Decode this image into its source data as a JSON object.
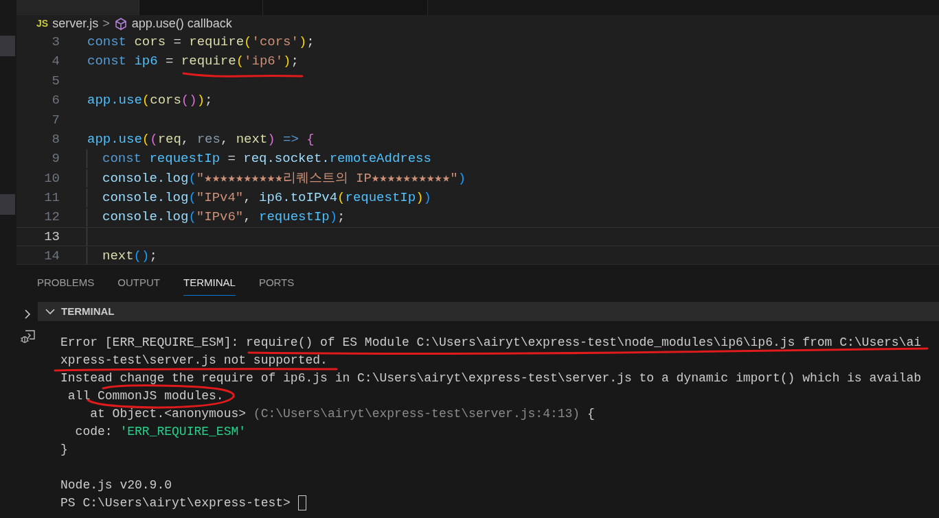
{
  "editor_tabs": [
    {
      "selected": true
    },
    {
      "selected": false
    },
    {
      "selected": false
    }
  ],
  "breadcrumb": {
    "file_badge": "JS",
    "file": "server.js",
    "separator": ">",
    "symbol": "app.use() callback"
  },
  "code_lines": [
    {
      "number": "3",
      "current": false,
      "guide": false,
      "tokens": [
        {
          "text": "const ",
          "color": "#569cd6"
        },
        {
          "text": "cors",
          "color": "#dcdcaa"
        },
        {
          "text": " = ",
          "color": "#d4d4d4"
        },
        {
          "text": "require",
          "color": "#dcdcaa"
        },
        {
          "text": "(",
          "color": "#ffd700"
        },
        {
          "text": "'cors'",
          "color": "#ce9178"
        },
        {
          "text": ")",
          "color": "#ffd700"
        },
        {
          "text": ";",
          "color": "#d4d4d4"
        }
      ]
    },
    {
      "number": "4",
      "current": false,
      "guide": false,
      "tokens": [
        {
          "text": "const ",
          "color": "#569cd6"
        },
        {
          "text": "ip6",
          "color": "#4fc1ff"
        },
        {
          "text": " = ",
          "color": "#d4d4d4"
        },
        {
          "text": "require",
          "color": "#dcdcaa"
        },
        {
          "text": "(",
          "color": "#ffd700"
        },
        {
          "text": "'ip6'",
          "color": "#ce9178"
        },
        {
          "text": ")",
          "color": "#ffd700"
        },
        {
          "text": ";",
          "color": "#d4d4d4"
        }
      ]
    },
    {
      "number": "5",
      "current": false,
      "guide": false
    },
    {
      "number": "6",
      "current": false,
      "guide": false,
      "tokens": [
        {
          "text": "app.use",
          "color": "#4fc1ff"
        },
        {
          "text": "(",
          "color": "#ffd700"
        },
        {
          "text": "cors",
          "color": "#dcdcaa"
        },
        {
          "text": "()",
          "color": "#da70d6"
        },
        {
          "text": ")",
          "color": "#ffd700"
        },
        {
          "text": ";",
          "color": "#d4d4d4"
        }
      ]
    },
    {
      "number": "7",
      "current": false,
      "guide": false
    },
    {
      "number": "8",
      "current": false,
      "guide": false,
      "tokens": [
        {
          "text": "app.use",
          "color": "#4fc1ff"
        },
        {
          "text": "(",
          "color": "#ffd700"
        },
        {
          "text": "(",
          "color": "#da70d6"
        },
        {
          "text": "req",
          "color": "#dcdcaa"
        },
        {
          "text": ", ",
          "color": "#d4d4d4"
        },
        {
          "text": "res",
          "color": "#8a9ba8"
        },
        {
          "text": ", ",
          "color": "#d4d4d4"
        },
        {
          "text": "next",
          "color": "#dcdcaa"
        },
        {
          "text": ")",
          "color": "#da70d6"
        },
        {
          "text": " => ",
          "color": "#569cd6"
        },
        {
          "text": "{",
          "color": "#da70d6"
        }
      ]
    },
    {
      "number": "9",
      "current": false,
      "guide": true,
      "tokens": [
        {
          "text": "const ",
          "color": "#569cd6"
        },
        {
          "text": "requestIp",
          "color": "#4fc1ff"
        },
        {
          "text": " = ",
          "color": "#d4d4d4"
        },
        {
          "text": "req.socket.",
          "color": "#9cdcfe"
        },
        {
          "text": "remoteAddress",
          "color": "#4fc1ff"
        }
      ]
    },
    {
      "number": "10",
      "current": false,
      "guide": true,
      "tokens": [
        {
          "text": "console.log",
          "color": "#9cdcfe"
        },
        {
          "text": "(",
          "color": "#179fff"
        },
        {
          "text": "\"★★★★★★★★★★리퀘스트의 IP★★★★★★★★★★\"",
          "color": "#ce9178"
        },
        {
          "text": ")",
          "color": "#179fff"
        }
      ]
    },
    {
      "number": "11",
      "current": false,
      "guide": true,
      "tokens": [
        {
          "text": "console.log",
          "color": "#9cdcfe"
        },
        {
          "text": "(",
          "color": "#179fff"
        },
        {
          "text": "\"IPv4\"",
          "color": "#ce9178"
        },
        {
          "text": ", ",
          "color": "#d4d4d4"
        },
        {
          "text": "ip6.toIPv4",
          "color": "#9cdcfe"
        },
        {
          "text": "(",
          "color": "#ffd700"
        },
        {
          "text": "requestIp",
          "color": "#4fc1ff"
        },
        {
          "text": ")",
          "color": "#ffd700"
        },
        {
          "text": ")",
          "color": "#179fff"
        }
      ]
    },
    {
      "number": "12",
      "current": false,
      "guide": true,
      "tokens": [
        {
          "text": "console.log",
          "color": "#9cdcfe"
        },
        {
          "text": "(",
          "color": "#179fff"
        },
        {
          "text": "\"IPv6\"",
          "color": "#ce9178"
        },
        {
          "text": ", ",
          "color": "#d4d4d4"
        },
        {
          "text": "requestIp",
          "color": "#4fc1ff"
        },
        {
          "text": ")",
          "color": "#179fff"
        },
        {
          "text": ";",
          "color": "#d4d4d4"
        }
      ]
    },
    {
      "number": "13",
      "current": true,
      "guide": true
    },
    {
      "number": "14",
      "current": false,
      "guide": true,
      "tokens": [
        {
          "text": "next",
          "color": "#dcdcaa"
        },
        {
          "text": "()",
          "color": "#179fff"
        },
        {
          "text": ";",
          "color": "#d4d4d4"
        }
      ]
    }
  ],
  "panel_tabs": [
    {
      "label": "PROBLEMS",
      "selected": false
    },
    {
      "label": "OUTPUT",
      "selected": false
    },
    {
      "label": "TERMINAL",
      "selected": true
    },
    {
      "label": "PORTS",
      "selected": false
    }
  ],
  "terminal": {
    "title": "TERMINAL",
    "lines": [
      {
        "segments": [
          {
            "text": "Error [ERR_REQUIRE_ESM]: require() of ES Module C:\\Users\\airyt\\express-test\\node_modules\\ip6\\ip6.js from C:\\Users\\ai",
            "color": "#cccccc"
          }
        ]
      },
      {
        "segments": [
          {
            "text": "xpress-test\\server.js not supported.",
            "color": "#cccccc"
          }
        ]
      },
      {
        "segments": [
          {
            "text": "Instead change the require of ip6.js in C:\\Users\\airyt\\express-test\\server.js to a dynamic import() which is availab",
            "color": "#cccccc"
          }
        ]
      },
      {
        "segments": [
          {
            "text": " all CommonJS modules.",
            "color": "#cccccc"
          }
        ]
      },
      {
        "segments": [
          {
            "text": "    at Object.<anonymous> ",
            "color": "#cccccc"
          },
          {
            "text": "(C:\\Users\\airyt\\express-test\\server.js:4:13)",
            "color": "#8b8b8b"
          },
          {
            "text": " {",
            "color": "#cccccc"
          }
        ]
      },
      {
        "segments": [
          {
            "text": "  code: ",
            "color": "#cccccc"
          },
          {
            "text": "'ERR_REQUIRE_ESM'",
            "color": "#23d18b"
          }
        ]
      },
      {
        "segments": [
          {
            "text": "}",
            "color": "#cccccc"
          }
        ],
        "blank_after": true
      },
      {
        "segments": [
          {
            "text": "Node.js v20.9.0",
            "color": "#cccccc"
          }
        ]
      },
      {
        "segments": [
          {
            "text": "PS C:\\Users\\airyt\\express-test> ",
            "color": "#cccccc"
          }
        ],
        "cursor": true
      }
    ]
  }
}
